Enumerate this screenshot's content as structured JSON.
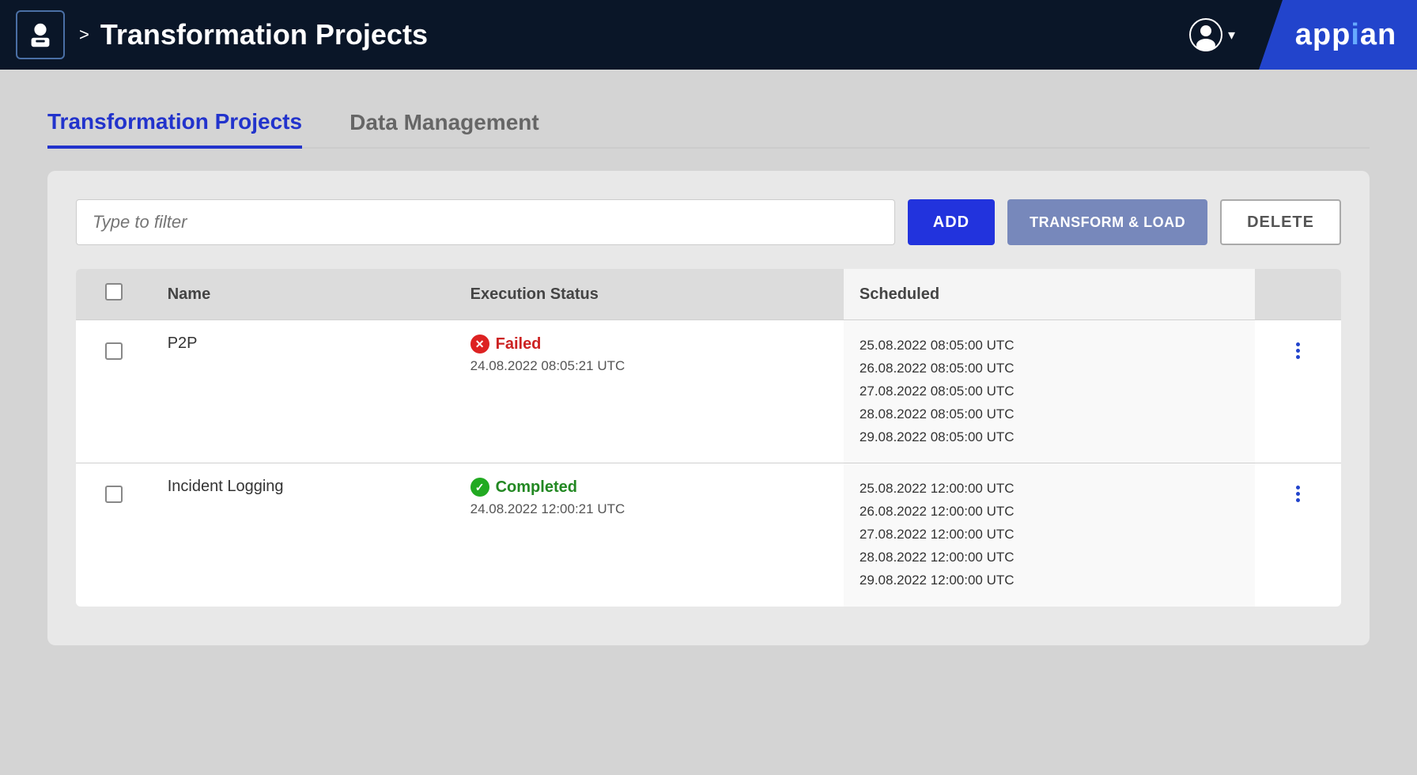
{
  "header": {
    "icon_alt": "app-icon",
    "chevron": ">",
    "title": "Transformation Projects",
    "user_icon": "user-icon",
    "dropdown_chevron": "▾",
    "appian_logo": "appian"
  },
  "tabs": [
    {
      "id": "transformation-projects",
      "label": "Transformation Projects",
      "active": true
    },
    {
      "id": "data-management",
      "label": "Data Management",
      "active": false
    }
  ],
  "toolbar": {
    "filter_placeholder": "Type to filter",
    "add_label": "ADD",
    "transform_label": "TRANSFORM & LOAD",
    "delete_label": "DELETE"
  },
  "table": {
    "columns": [
      {
        "id": "checkbox",
        "label": ""
      },
      {
        "id": "name",
        "label": "Name"
      },
      {
        "id": "execution_status",
        "label": "Execution Status"
      },
      {
        "id": "scheduled",
        "label": "Scheduled"
      },
      {
        "id": "action",
        "label": ""
      }
    ],
    "rows": [
      {
        "id": "p2p",
        "name": "P2P",
        "status_type": "failed",
        "status_label": "Failed",
        "status_time": "24.08.2022 08:05:21 UTC",
        "scheduled": [
          "25.08.2022 08:05:00 UTC",
          "26.08.2022 08:05:00 UTC",
          "27.08.2022 08:05:00 UTC",
          "28.08.2022 08:05:00 UTC",
          "29.08.2022 08:05:00 UTC"
        ]
      },
      {
        "id": "incident-logging",
        "name": "Incident Logging",
        "status_type": "completed",
        "status_label": "Completed",
        "status_time": "24.08.2022 12:00:21 UTC",
        "scheduled": [
          "25.08.2022 12:00:00 UTC",
          "26.08.2022 12:00:00 UTC",
          "27.08.2022 12:00:00 UTC",
          "28.08.2022 12:00:00 UTC",
          "29.08.2022 12:00:00 UTC"
        ]
      }
    ]
  },
  "colors": {
    "header_bg": "#0a1628",
    "appian_blue": "#2244cc",
    "active_tab": "#2233cc",
    "failed_red": "#dd2222",
    "completed_green": "#22aa22"
  }
}
